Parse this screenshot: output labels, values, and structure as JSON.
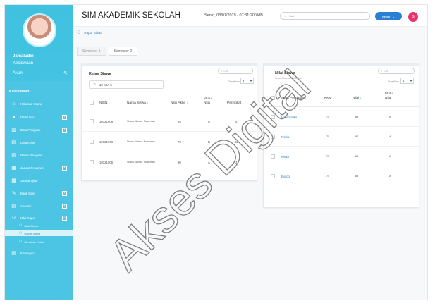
{
  "sidebar": {
    "user_name": "Jamaludin",
    "user_role": "Kesiswaan",
    "account_label": "Akun",
    "section_label": "Kesiswaan",
    "items": [
      {
        "label": "Halaman Utama",
        "icon": "home-icon",
        "expandable": false
      },
      {
        "label": "Data User",
        "icon": "user-icon",
        "expandable": true
      },
      {
        "label": "Data Pelajaran",
        "icon": "books-icon",
        "expandable": true
      },
      {
        "label": "Data Kelas",
        "icon": "document-icon",
        "expandable": false
      },
      {
        "label": "Materi Pelajaran",
        "icon": "document-icon",
        "expandable": false
      },
      {
        "label": "Jadwal Pelajaran",
        "icon": "schedule-icon",
        "expandable": true
      },
      {
        "label": "Jadwal Ujian",
        "icon": "schedule-icon",
        "expandable": false
      },
      {
        "label": "Bank Soal",
        "icon": "edit-icon",
        "expandable": true
      },
      {
        "label": "Absensi",
        "icon": "document-icon",
        "expandable": true
      },
      {
        "label": "Nilai Rapor",
        "icon": "users-icon",
        "expandable": true,
        "expanded": true
      }
    ],
    "sub_items": [
      {
        "label": "Nilai Siswa",
        "active": false
      },
      {
        "label": "Rapor Siswa",
        "active": true
      },
      {
        "label": "Kenaikan Kelas",
        "active": false
      }
    ],
    "last_item": {
      "label": "Keuangan",
      "icon": "document-icon"
    }
  },
  "header": {
    "title": "SIM AKADEMIK SEKOLAH",
    "datetime": "Senin, 08/07/2019 - 07:31:20 WIB",
    "search_placeholder": "Cari",
    "logout_label": "Keluar",
    "avatar_initial": "S"
  },
  "breadcrumb": "Rapor Siswa",
  "tabs": [
    {
      "label": "Semester 1",
      "active": false
    },
    {
      "label": "Semester 2",
      "active": true
    }
  ],
  "kelas_card": {
    "title": "Kelas Siswa",
    "search_placeholder": "Cari",
    "show_label": "Tampilkan",
    "page_size": "3",
    "kelas_value": "10 MIA 3",
    "columns": [
      "NISN",
      "Nama Siswa",
      "Nilai Akhir",
      "Mutu Nilai",
      "Peringkat"
    ],
    "rows": [
      {
        "nisn": "10121006",
        "nama": "Siswa Mansur Sulaeman",
        "nilai": "85",
        "mutu": "A",
        "peringkat": "4"
      },
      {
        "nisn": "10121006",
        "nama": "Siswa Mansur Sulaeman",
        "nilai": "75",
        "mutu": "B",
        "peringkat": "12"
      },
      {
        "nisn": "10121006",
        "nama": "Siswa Mansur Sulaeman",
        "nilai": "90",
        "mutu": "A",
        "peringkat": "3"
      }
    ]
  },
  "nilai_card": {
    "title": "Nilai Siswa",
    "subtitle": "Siswa Mansur Sulaeman",
    "search_placeholder": "Cari",
    "show_label": "Tampilkan",
    "page_size": "4",
    "columns": [
      "Mata Pelajaran",
      "KKM",
      "Nilai",
      "Mutu Nilai"
    ],
    "rows": [
      {
        "mapel": "Matematika",
        "kkm": "75",
        "nilai": "83",
        "mutu": "A"
      },
      {
        "mapel": "Fisika",
        "kkm": "75",
        "nilai": "82",
        "mutu": "A"
      },
      {
        "mapel": "Kimia",
        "kkm": "75",
        "nilai": "85",
        "mutu": "A"
      },
      {
        "mapel": "Biologi",
        "kkm": "75",
        "nilai": "83",
        "mutu": "A"
      }
    ]
  },
  "watermark": "Akses Digital",
  "colors": {
    "sidebar": "#4cc4e3",
    "accent_blue": "#2a7fd4",
    "notif": "#e8336e",
    "sort_arrow": "#3bbf7a"
  }
}
